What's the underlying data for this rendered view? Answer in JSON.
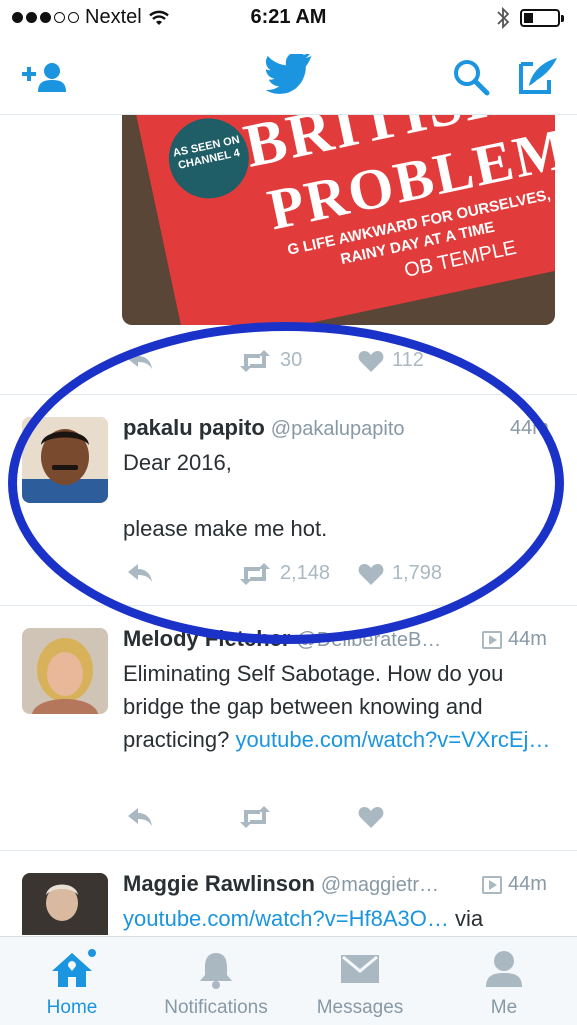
{
  "status_bar": {
    "carrier": "Nextel",
    "time": "6:21 AM"
  },
  "nav": {
    "icons": [
      "add-user-icon",
      "twitter-bird-icon",
      "search-icon",
      "compose-icon"
    ]
  },
  "tweets": [
    {
      "media_text": {
        "line1": "BRITISH",
        "line2": "PROBLEMS",
        "badge": "AS SEEN ON CHANNEL 4",
        "sub1": "G LIFE AWKWARD FOR OURSELVES,",
        "sub2": "RAINY DAY AT A TIME",
        "author": "OB TEMPLE"
      },
      "retweets": "30",
      "likes": "112"
    },
    {
      "name": "pakalu papito",
      "handle": "@pakalupapito",
      "time": "44m",
      "text_line1": "Dear 2016,",
      "text_line2": "please make me hot.",
      "retweets": "2,148",
      "likes": "1,798"
    },
    {
      "name": "Melody Fletcher",
      "handle": "@DeliberateB…",
      "time": "44m",
      "text": "Eliminating Self Sabotage. How do you bridge the gap between knowing and practicing?",
      "link": "youtube.com/watch?v=VXrcEj…"
    },
    {
      "name": "Maggie Rawlinson",
      "handle": "@maggietr…",
      "time": "44m",
      "link": "youtube.com/watch?v=Hf8A3O…",
      "text_after": " via"
    }
  ],
  "tabs": [
    {
      "label": "Home",
      "icon": "home-icon"
    },
    {
      "label": "Notifications",
      "icon": "bell-icon"
    },
    {
      "label": "Messages",
      "icon": "envelope-icon"
    },
    {
      "label": "Me",
      "icon": "person-icon"
    }
  ],
  "colors": {
    "accent": "#1b95e0",
    "muted": "#aab8c2",
    "annotation_circle": "#1b32c9"
  }
}
